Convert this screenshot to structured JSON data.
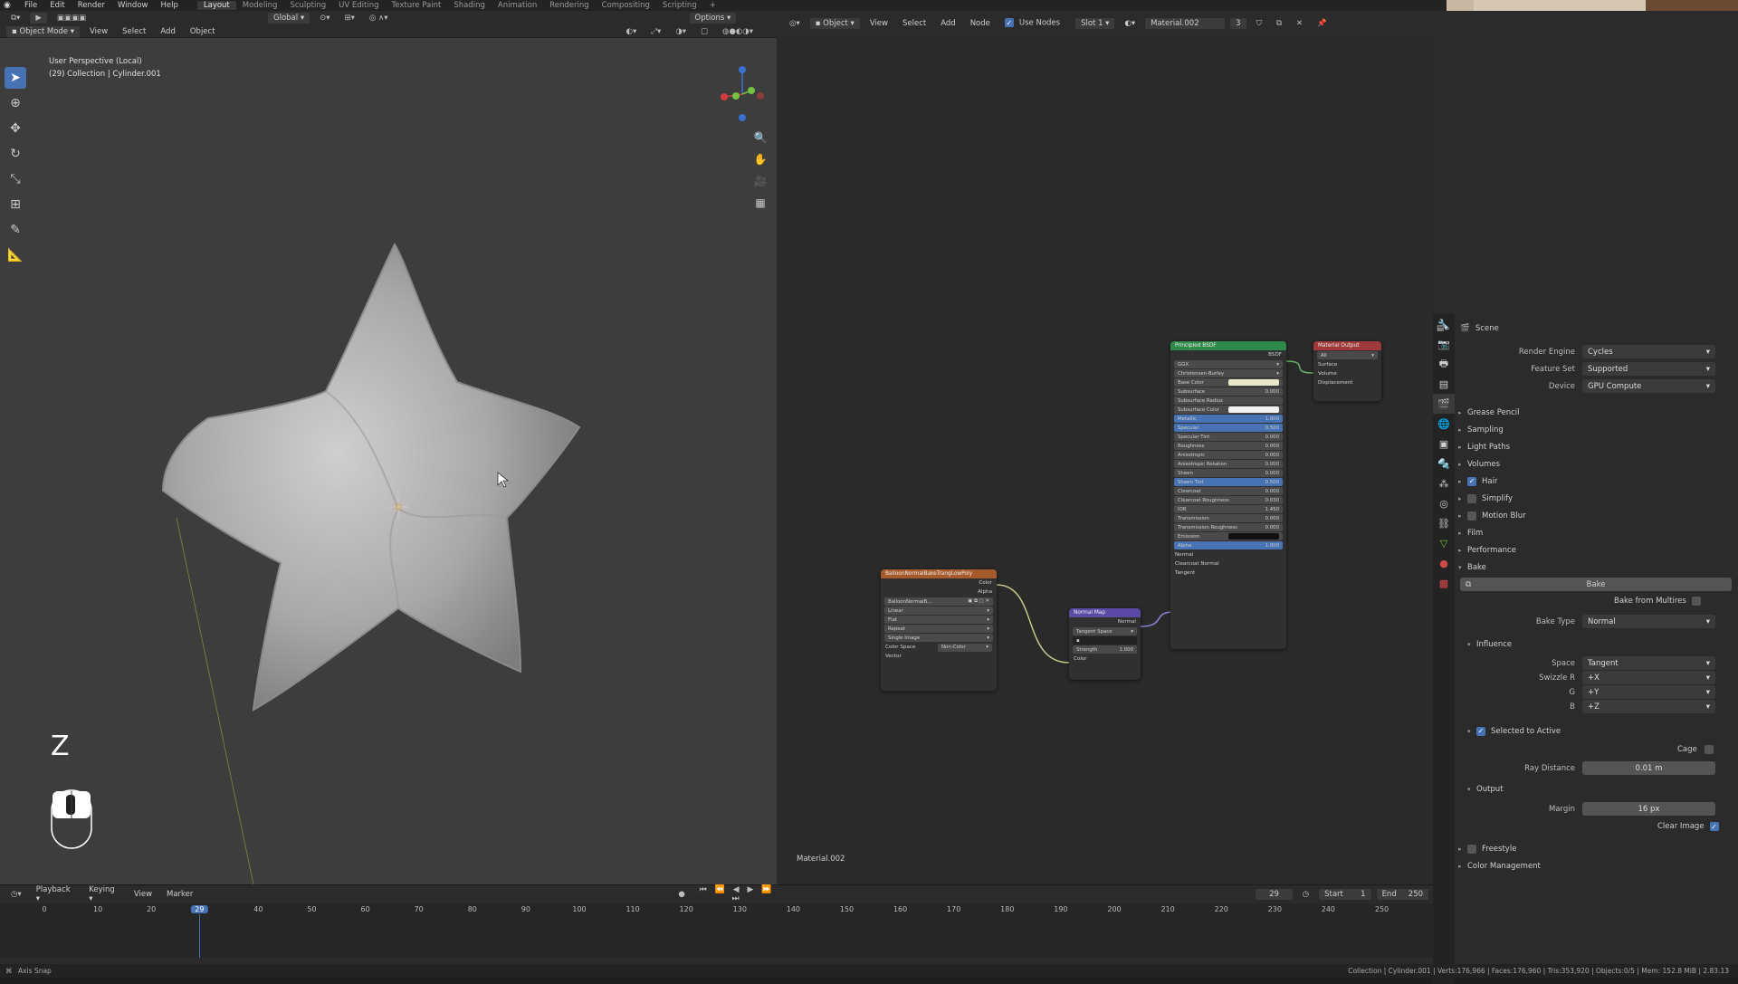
{
  "topbar": {
    "menus": [
      "File",
      "Edit",
      "Render",
      "Window",
      "Help"
    ],
    "workspaces": [
      "Layout",
      "Modeling",
      "Sculpting",
      "UV Editing",
      "Texture Paint",
      "Shading",
      "Animation",
      "Rendering",
      "Compositing",
      "Scripting"
    ],
    "active_workspace": "Layout"
  },
  "viewport": {
    "mode": "Object Mode",
    "menus": [
      "View",
      "Select",
      "Add",
      "Object"
    ],
    "orientation": "Global",
    "options": "Options",
    "overlay_title": "User Perspective (Local)",
    "overlay_collection": "(29) Collection | Cylinder.001",
    "key_hint": "Z"
  },
  "node_editor": {
    "type": "Object",
    "menus": [
      "View",
      "Select",
      "Add",
      "Node"
    ],
    "use_nodes": "Use Nodes",
    "slot": "Slot 1",
    "material": "Material.002",
    "user_count": "3",
    "footer_label": "Material.002",
    "image_node": {
      "title": "BalloonNormalBakeTrangLowPoly",
      "out_color": "Color",
      "out_alpha": "Alpha",
      "image_name": "BalloonNormalB...",
      "interp": "Linear",
      "projection": "Flat",
      "extension": "Repeat",
      "source": "Single Image",
      "color_space_label": "Color Space",
      "color_space": "Non-Color",
      "vector": "Vector"
    },
    "normal_map_node": {
      "title": "Normal Map",
      "out": "Normal",
      "space": "Tangent Space",
      "strength_label": "Strength",
      "strength": "1.000",
      "color": "Color"
    },
    "bsdf_node": {
      "title": "Principled BSDF",
      "out": "BSDF",
      "distribution": "GGX",
      "subsurface_method": "Christensen-Burley",
      "rows": [
        {
          "label": "Base Color",
          "value": ""
        },
        {
          "label": "Subsurface",
          "value": "0.000"
        },
        {
          "label": "Subsurface Radius",
          "value": ""
        },
        {
          "label": "Subsurface Color",
          "value": ""
        },
        {
          "label": "Metallic",
          "value": "1.000"
        },
        {
          "label": "Specular",
          "value": "0.500"
        },
        {
          "label": "Specular Tint",
          "value": "0.000"
        },
        {
          "label": "Roughness",
          "value": "0.000"
        },
        {
          "label": "Anisotropic",
          "value": "0.000"
        },
        {
          "label": "Anisotropic Rotation",
          "value": "0.000"
        },
        {
          "label": "Sheen",
          "value": "0.000"
        },
        {
          "label": "Sheen Tint",
          "value": "0.500"
        },
        {
          "label": "Clearcoat",
          "value": "0.000"
        },
        {
          "label": "Clearcoat Roughness",
          "value": "0.030"
        },
        {
          "label": "IOR",
          "value": "1.450"
        },
        {
          "label": "Transmission",
          "value": "0.000"
        },
        {
          "label": "Transmission Roughness",
          "value": "0.000"
        },
        {
          "label": "Emission",
          "value": ""
        },
        {
          "label": "Alpha",
          "value": "1.000"
        }
      ],
      "inputs": [
        "Normal",
        "Clearcoat Normal",
        "Tangent"
      ]
    },
    "output_node": {
      "title": "Material Output",
      "target": "All",
      "inputs": [
        "Surface",
        "Volume",
        "Displacement"
      ]
    }
  },
  "properties": {
    "context": "Scene",
    "render_engine_label": "Render Engine",
    "render_engine": "Cycles",
    "feature_set_label": "Feature Set",
    "feature_set": "Supported",
    "device_label": "Device",
    "device": "GPU Compute",
    "panels": [
      "Grease Pencil",
      "Sampling",
      "Light Paths",
      "Volumes",
      "Hair",
      "Simplify",
      "Motion Blur",
      "Film",
      "Performance",
      "Bake"
    ],
    "bake_button": "Bake",
    "bake_from_multires": "Bake from Multires",
    "bake_type_label": "Bake Type",
    "bake_type": "Normal",
    "influence": "Influence",
    "space_label": "Space",
    "space": "Tangent",
    "swizzle_r_label": "Swizzle R",
    "swizzle_r": "+X",
    "swizzle_g_label": "G",
    "swizzle_g": "+Y",
    "swizzle_b_label": "B",
    "swizzle_b": "+Z",
    "selected_to_active": "Selected to Active",
    "cage": "Cage",
    "ray_distance_label": "Ray Distance",
    "ray_distance": "0.01 m",
    "output": "Output",
    "margin_label": "Margin",
    "margin": "16 px",
    "clear_image": "Clear Image",
    "bottom_panels": [
      "Freestyle",
      "Color Management"
    ]
  },
  "timeline": {
    "menus": [
      "Playback",
      "Keying",
      "View",
      "Marker"
    ],
    "current_frame": "29",
    "start_label": "Start",
    "start": "1",
    "end_label": "End",
    "end": "250",
    "ticks": [
      "0",
      "10",
      "20",
      "29",
      "40",
      "50",
      "60",
      "70",
      "80",
      "90",
      "100",
      "110",
      "120",
      "130",
      "140",
      "150",
      "160",
      "170",
      "180",
      "190",
      "200",
      "210",
      "220",
      "230",
      "240",
      "250"
    ]
  },
  "status": {
    "left": "Axis Snap",
    "right": "Collection | Cylinder.001 | Verts:176,966 | Faces:176,960 | Tris:353,920 | Objects:0/5 | Mem: 152.8 MiB | 2.83.13"
  },
  "colors": {
    "accent": "#4772b3",
    "viewport_bg": "#3d3d3d",
    "node_bg": "#2a2a2a",
    "bsdf_header": "#2f8a4a",
    "output_header": "#a03a3a",
    "image_header": "#a65a2a",
    "normalmap_header": "#5a4aa6"
  }
}
